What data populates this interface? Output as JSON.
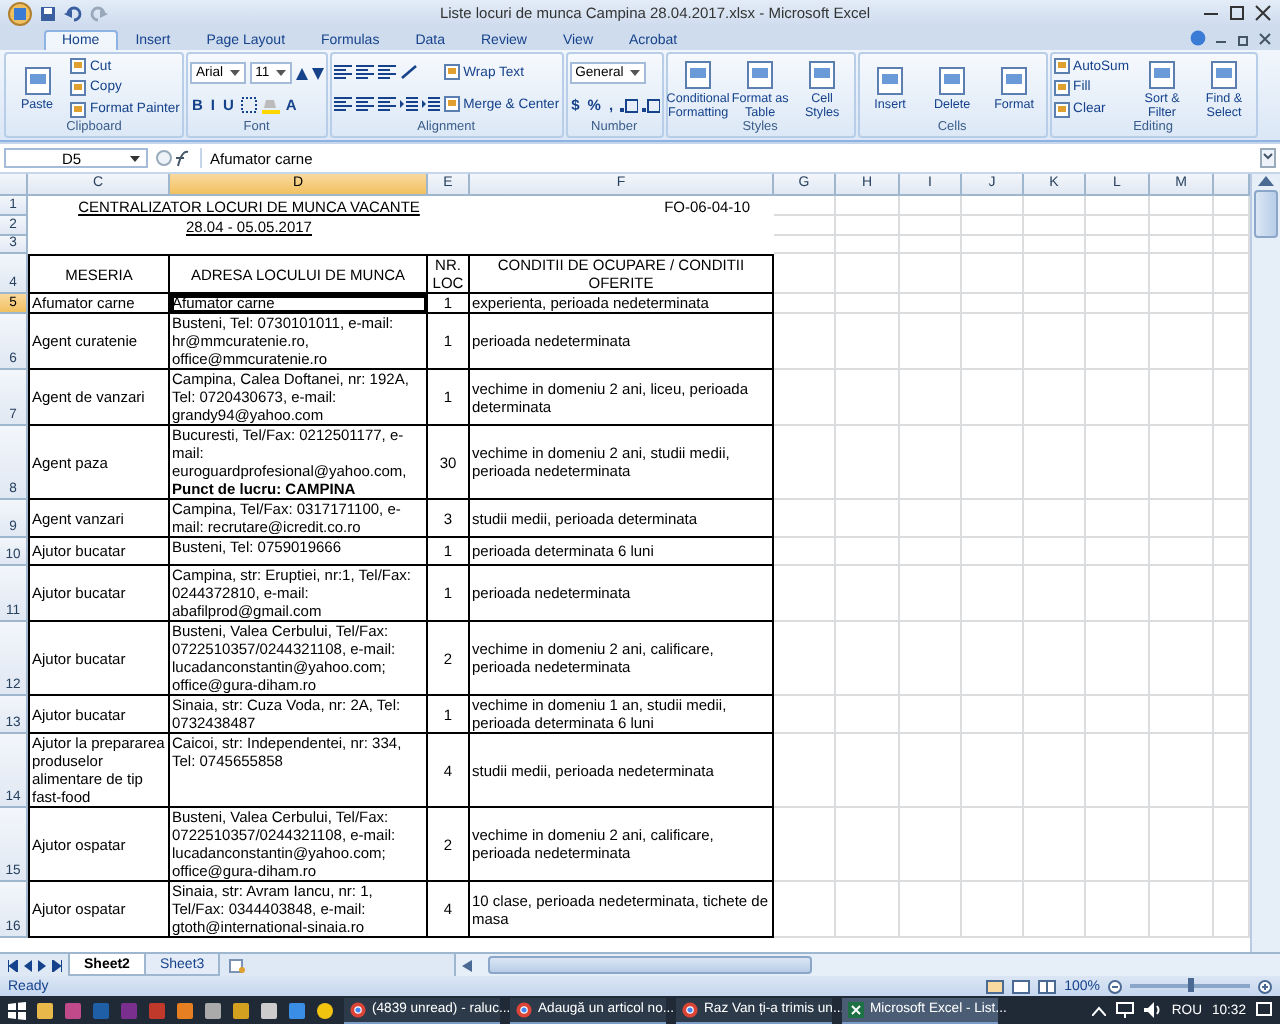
{
  "window": {
    "title": "Liste locuri de munca Campina 28.04.2017.xlsx - Microsoft Excel"
  },
  "ribbon_tabs": [
    {
      "label": "Home",
      "selected": true
    },
    {
      "label": "Insert",
      "selected": false
    },
    {
      "label": "Page Layout",
      "selected": false
    },
    {
      "label": "Formulas",
      "selected": false
    },
    {
      "label": "Data",
      "selected": false
    },
    {
      "label": "Review",
      "selected": false
    },
    {
      "label": "View",
      "selected": false
    },
    {
      "label": "Acrobat",
      "selected": false
    }
  ],
  "ribbon_groups": [
    {
      "label": "Clipboard",
      "columns": [
        [
          [
            {
              "kind": "large",
              "label": "Paste"
            }
          ]
        ],
        [
          [
            {
              "kind": "small",
              "label": "Cut"
            }
          ],
          [
            {
              "kind": "small",
              "label": "Copy"
            }
          ],
          [
            {
              "kind": "small",
              "label": "Format Painter"
            }
          ]
        ]
      ]
    },
    {
      "label": "Font",
      "columns": [
        [
          [
            {
              "kind": "field",
              "label": "Arial"
            },
            {
              "kind": "field",
              "label": "11"
            },
            {
              "kind": "grow"
            },
            {
              "kind": "shrink"
            }
          ],
          [
            {
              "kind": "glyph",
              "label": "B"
            },
            {
              "kind": "glyph",
              "label": "I"
            },
            {
              "kind": "glyph",
              "label": "U"
            },
            {
              "kind": "borders"
            },
            {
              "kind": "fill"
            },
            {
              "kind": "glyph",
              "label": "A"
            }
          ]
        ]
      ]
    },
    {
      "label": "Alignment",
      "columns": [
        [
          [
            {
              "kind": "lines"
            },
            {
              "kind": "lines"
            },
            {
              "kind": "lines"
            },
            {
              "kind": "orient"
            }
          ],
          [
            {
              "kind": "lines"
            },
            {
              "kind": "lines"
            },
            {
              "kind": "lines"
            },
            {
              "kind": "indent"
            },
            {
              "kind": "indent"
            }
          ]
        ],
        [
          [
            {
              "kind": "small",
              "label": "Wrap Text"
            }
          ],
          [
            {
              "kind": "small",
              "label": "Merge & Center"
            }
          ]
        ]
      ]
    },
    {
      "label": "Number",
      "columns": [
        [
          [
            {
              "kind": "field",
              "label": "General"
            }
          ],
          [
            {
              "kind": "glyph",
              "label": "$"
            },
            {
              "kind": "glyph",
              "label": "%"
            },
            {
              "kind": "glyph",
              "label": ","
            },
            {
              "kind": "decimals"
            },
            {
              "kind": "decimals"
            }
          ]
        ]
      ]
    },
    {
      "label": "Styles",
      "columns": [
        [
          [
            {
              "kind": "large",
              "label": "Conditional Formatting"
            }
          ]
        ],
        [
          [
            {
              "kind": "large",
              "label": "Format as Table"
            }
          ]
        ],
        [
          [
            {
              "kind": "large",
              "label": "Cell Styles"
            }
          ]
        ]
      ]
    },
    {
      "label": "Cells",
      "columns": [
        [
          [
            {
              "kind": "large",
              "label": "Insert"
            }
          ]
        ],
        [
          [
            {
              "kind": "large",
              "label": "Delete"
            }
          ]
        ],
        [
          [
            {
              "kind": "large",
              "label": "Format"
            }
          ]
        ]
      ]
    },
    {
      "label": "Editing",
      "columns": [
        [
          [
            {
              "kind": "small",
              "label": "AutoSum"
            }
          ],
          [
            {
              "kind": "small",
              "label": "Fill"
            }
          ],
          [
            {
              "kind": "small",
              "label": "Clear"
            }
          ]
        ],
        [
          [
            {
              "kind": "large",
              "label": "Sort & Filter"
            }
          ]
        ],
        [
          [
            {
              "kind": "large",
              "label": "Find & Select"
            }
          ]
        ]
      ]
    }
  ],
  "formula_bar": {
    "name_box": "D5",
    "formula": "Afumator carne"
  },
  "sheet": {
    "columns": [
      {
        "label": "C",
        "selected": false
      },
      {
        "label": "D",
        "selected": true
      },
      {
        "label": "E",
        "selected": false
      },
      {
        "label": "F",
        "selected": false
      },
      {
        "label": "G",
        "selected": false
      },
      {
        "label": "H",
        "selected": false
      },
      {
        "label": "I",
        "selected": false
      },
      {
        "label": "J",
        "selected": false
      },
      {
        "label": "K",
        "selected": false
      },
      {
        "label": "L",
        "selected": false
      },
      {
        "label": "M",
        "selected": false
      }
    ],
    "rows": [
      {
        "label": "1",
        "selected": false
      },
      {
        "label": "2",
        "selected": false
      },
      {
        "label": "3",
        "selected": false
      },
      {
        "label": "4",
        "selected": false
      },
      {
        "label": "5",
        "selected": true
      },
      {
        "label": "6",
        "selected": false
      },
      {
        "label": "7",
        "selected": false
      },
      {
        "label": "8",
        "selected": false
      },
      {
        "label": "9",
        "selected": false
      },
      {
        "label": "10",
        "selected": false
      },
      {
        "label": "11",
        "selected": false
      },
      {
        "label": "12",
        "selected": false
      },
      {
        "label": "13",
        "selected": false
      },
      {
        "label": "14",
        "selected": false
      },
      {
        "label": "15",
        "selected": false
      },
      {
        "label": "16",
        "selected": false
      }
    ],
    "title": "CENTRALIZATOR LOCURI DE MUNCA VACANTE",
    "period": "28.04 - 05.05.2017",
    "form_code": "FO-06-04-10",
    "headers": [
      "MESERIA",
      "ADRESA LOCULUI DE MUNCA",
      "NR. LOC",
      "CONDITII DE OCUPARE / CONDITII OFERITE"
    ],
    "records": [
      {
        "meseria": "Afumator carne",
        "adresa": "Afumator carne",
        "nr_loc": "1",
        "conditii": "experienta, perioada nedeterminata"
      },
      {
        "meseria": "Agent curatenie",
        "adresa": "Busteni, Tel: 0730101011, e-mail: hr@mmcuratenie.ro, office@mmcuratenie.ro",
        "nr_loc": "1",
        "conditii": "perioada nedeterminata"
      },
      {
        "meseria": "Agent de vanzari",
        "adresa": "Campina, Calea Doftanei, nr: 192A, Tel: 0720430673, e-mail: grandy94@yahoo.com",
        "nr_loc": "1",
        "conditii": "vechime in domeniu 2 ani, liceu, perioada determinata"
      },
      {
        "meseria": "Agent paza",
        "adresa": "Bucuresti, Tel/Fax: 0212501177, e-mail: euroguardprofesional@yahoo.com, **Punct de lucru: CAMPINA**",
        "nr_loc": "30",
        "conditii": "vechime in domeniu 2 ani, studii medii, perioada nedeterminata"
      },
      {
        "meseria": "Agent vanzari",
        "adresa": "Campina, Tel/Fax: 0317171100, e-mail: recrutare@icredit.co.ro",
        "nr_loc": "3",
        "conditii": "studii medii, perioada determinata"
      },
      {
        "meseria": "Ajutor bucatar",
        "adresa": "Busteni, Tel: 0759019666",
        "nr_loc": "1",
        "conditii": "perioada determinata 6 luni"
      },
      {
        "meseria": "Ajutor bucatar",
        "adresa": "Campina, str: Eruptiei, nr:1, Tel/Fax: 0244372810, e-mail: abafilprod@gmail.com",
        "nr_loc": "1",
        "conditii": "perioada nedeterminata"
      },
      {
        "meseria": "Ajutor bucatar",
        "adresa": "Busteni, Valea Cerbului, Tel/Fax: 0722510357/0244321108, e-mail: lucadanconstantin@yahoo.com; office@gura-diham.ro",
        "nr_loc": "2",
        "conditii": "vechime in domeniu 2 ani, calificare, perioada nedeterminata"
      },
      {
        "meseria": "Ajutor bucatar",
        "adresa": "Sinaia, str: Cuza Voda, nr: 2A, Tel: 0732438487",
        "nr_loc": "1",
        "conditii": "vechime in domeniu 1 an, studii medii, perioada determinata 6 luni"
      },
      {
        "meseria": "Ajutor la prepararea produselor alimentare de tip fast-food",
        "adresa": "Caicoi, str: Independentei, nr: 334, Tel: 0745655858",
        "nr_loc": "4",
        "conditii": "studii medii, perioada nedeterminata"
      },
      {
        "meseria": "Ajutor ospatar",
        "adresa": "Busteni, Valea Cerbului, Tel/Fax: 0722510357/0244321108, e-mail: lucadanconstantin@yahoo.com; office@gura-diham.ro",
        "nr_loc": "2",
        "conditii": "vechime in domeniu 2 ani, calificare, perioada nedeterminata"
      },
      {
        "meseria": "Ajutor ospatar",
        "adresa": "Sinaia, str: Avram Iancu, nr: 1, Tel/Fax: 0344403848, e-mail: gtoth@international-sinaia.ro",
        "nr_loc": "4",
        "conditii": "10 clase, perioada nedeterminata, tichete de masa"
      }
    ]
  },
  "sheet_tabs": [
    {
      "label": "Sheet2",
      "selected": true
    },
    {
      "label": "Sheet3",
      "selected": false
    }
  ],
  "status_bar": {
    "status": "Ready",
    "zoom": {
      "reading": "100%",
      "level": 0.5
    }
  },
  "taskbar": {
    "windows": [
      {
        "label": "(4839 unread) - raluc...",
        "kind": "browser",
        "selected": false
      },
      {
        "label": "Adaugă un articol no...",
        "kind": "browser",
        "selected": false
      },
      {
        "label": "Raz Van ți-a trimis un...",
        "kind": "browser",
        "selected": false
      },
      {
        "label": "Microsoft Excel - List...",
        "kind": "excel",
        "selected": true
      }
    ],
    "language": "ROU",
    "time": "10:32"
  }
}
